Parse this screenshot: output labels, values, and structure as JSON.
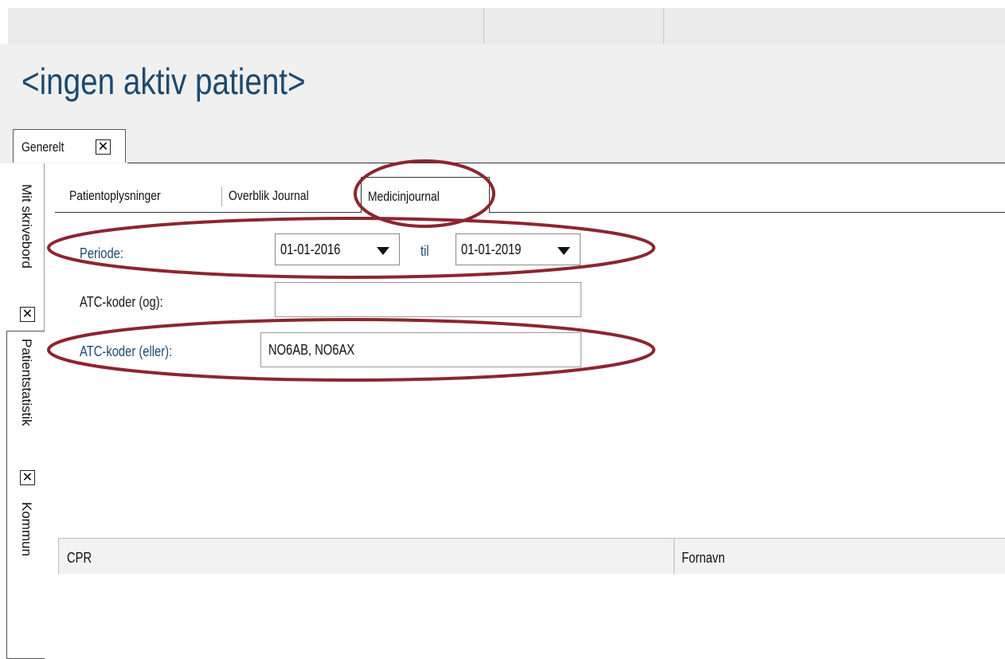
{
  "header": {
    "patient_title": "<ingen aktiv patient>"
  },
  "outer_tabs": {
    "generelt": "Generelt",
    "close": "✕"
  },
  "side_tabs": {
    "mit_skrivebord": "Mit skrivebord",
    "patientstatistik": "Patientstatistik",
    "kommune": "Kommun",
    "close": "✕"
  },
  "inner_tabs": {
    "patientoplysninger": "Patientoplysninger",
    "overblik_journal": "Overblik Journal",
    "medicinjournal": "Medicinjournal"
  },
  "form": {
    "periode_label": "Periode:",
    "from_date": "01-01-2016",
    "til_label": "til",
    "to_date": "01-01-2019",
    "atc_og_label": "ATC-koder (og):",
    "atc_og_value": "",
    "atc_eller_label": "ATC-koder (eller):",
    "atc_eller_value": "NO6AB, NO6AX"
  },
  "table": {
    "columns": [
      "CPR",
      "Fornavn"
    ]
  },
  "colors": {
    "title_blue": "#1c4a70",
    "annotation": "#8b2630"
  },
  "icons": {
    "close": "close-icon",
    "dropdown": "chevron-down-icon"
  }
}
